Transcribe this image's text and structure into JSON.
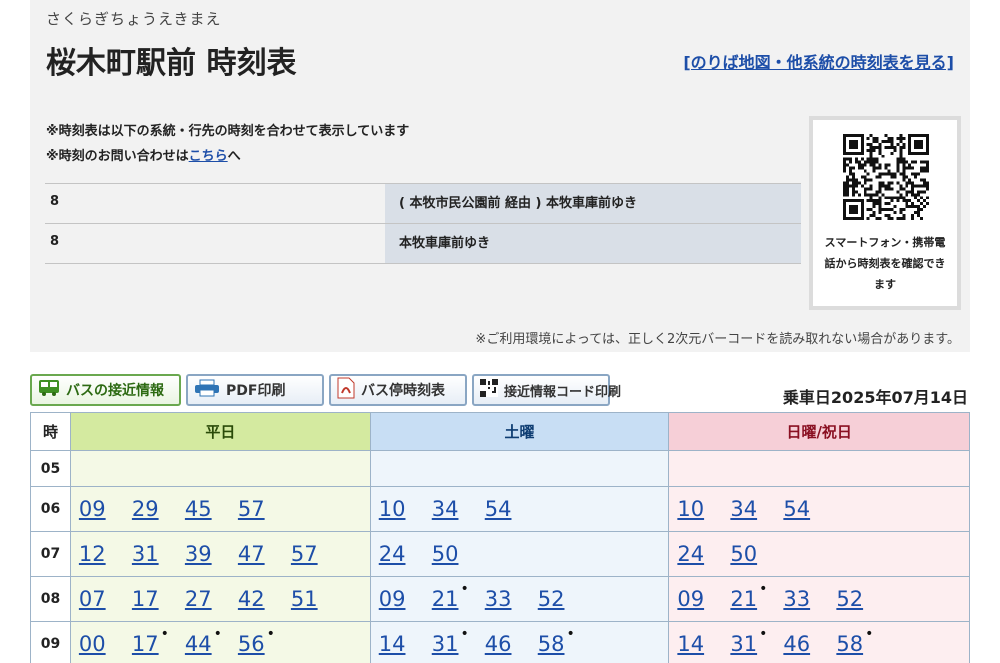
{
  "stop": {
    "kana": "さくらぎちょうえきまえ",
    "title": "桜木町駅前 時刻表",
    "map_link": "[のりば地図・他系統の時刻表を見る]"
  },
  "notes": {
    "line1": "※時刻表は以下の系統・行先の時刻を合わせて表示しています",
    "line2_prefix": "※時刻のお問い合わせは",
    "line2_link": "こちら",
    "line2_suffix": "へ"
  },
  "routes": [
    {
      "number": "8",
      "destination": "( 本牧市民公園前 経由 ) 本牧車庫前ゆき"
    },
    {
      "number": "8",
      "destination": "本牧車庫前ゆき"
    }
  ],
  "qr": {
    "icon": "qr-code-icon",
    "caption": "スマートフォン・携帯電話から時刻表を確認できます",
    "note": "※ご利用環境によっては、正しく2次元バーコードを読み取れない場合があります。"
  },
  "toolbar": {
    "approach_label": "バスの接近情報",
    "pdf_label": "PDF印刷",
    "stop_timetable_label": "バス停時刻表",
    "approach_code_label": "接近情報コード印刷"
  },
  "ride_date": "乗車日2025年07月14日",
  "timetable": {
    "headers": {
      "hour": "時",
      "weekday": "平日",
      "saturday": "土曜",
      "holiday": "日曜/祝日"
    },
    "rows": [
      {
        "hour": "05",
        "weekday": [],
        "saturday": [],
        "holiday": []
      },
      {
        "hour": "06",
        "weekday": [
          {
            "m": "09",
            "dot": false
          },
          {
            "m": "29",
            "dot": false
          },
          {
            "m": "45",
            "dot": false
          },
          {
            "m": "57",
            "dot": false
          }
        ],
        "saturday": [
          {
            "m": "10",
            "dot": false
          },
          {
            "m": "34",
            "dot": false
          },
          {
            "m": "54",
            "dot": false
          }
        ],
        "holiday": [
          {
            "m": "10",
            "dot": false
          },
          {
            "m": "34",
            "dot": false
          },
          {
            "m": "54",
            "dot": false
          }
        ]
      },
      {
        "hour": "07",
        "weekday": [
          {
            "m": "12",
            "dot": false
          },
          {
            "m": "31",
            "dot": false
          },
          {
            "m": "39",
            "dot": false
          },
          {
            "m": "47",
            "dot": false
          },
          {
            "m": "57",
            "dot": false
          }
        ],
        "saturday": [
          {
            "m": "24",
            "dot": false
          },
          {
            "m": "50",
            "dot": false
          }
        ],
        "holiday": [
          {
            "m": "24",
            "dot": false
          },
          {
            "m": "50",
            "dot": false
          }
        ]
      },
      {
        "hour": "08",
        "weekday": [
          {
            "m": "07",
            "dot": false
          },
          {
            "m": "17",
            "dot": false
          },
          {
            "m": "27",
            "dot": false
          },
          {
            "m": "42",
            "dot": false
          },
          {
            "m": "51",
            "dot": false
          }
        ],
        "saturday": [
          {
            "m": "09",
            "dot": false
          },
          {
            "m": "21",
            "dot": true
          },
          {
            "m": "33",
            "dot": false
          },
          {
            "m": "52",
            "dot": false
          }
        ],
        "holiday": [
          {
            "m": "09",
            "dot": false
          },
          {
            "m": "21",
            "dot": true
          },
          {
            "m": "33",
            "dot": false
          },
          {
            "m": "52",
            "dot": false
          }
        ]
      },
      {
        "hour": "09",
        "weekday": [
          {
            "m": "00",
            "dot": false
          },
          {
            "m": "17",
            "dot": true
          },
          {
            "m": "44",
            "dot": true
          },
          {
            "m": "56",
            "dot": true
          }
        ],
        "saturday": [
          {
            "m": "14",
            "dot": false
          },
          {
            "m": "31",
            "dot": true
          },
          {
            "m": "46",
            "dot": false
          },
          {
            "m": "58",
            "dot": true
          }
        ],
        "holiday": [
          {
            "m": "14",
            "dot": false
          },
          {
            "m": "31",
            "dot": true
          },
          {
            "m": "46",
            "dot": false
          },
          {
            "m": "58",
            "dot": true
          }
        ]
      }
    ]
  },
  "colors": {
    "link": "#1d4ea8",
    "weekday_header": "#d4eaa0",
    "saturday_header": "#c8def4",
    "holiday_header": "#f6cfd7"
  }
}
